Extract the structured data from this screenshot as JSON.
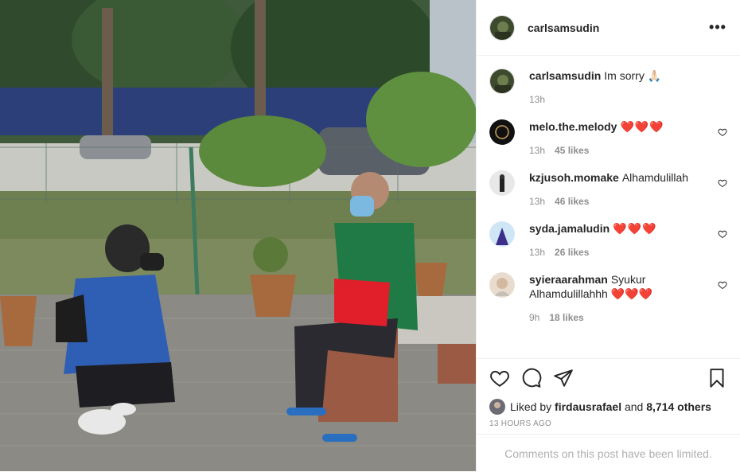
{
  "post": {
    "author": "carlsamsudin",
    "caption": "Im sorry 🙏🏻",
    "caption_time": "13h"
  },
  "comments": [
    {
      "user": "melo.the.melody",
      "text": "❤️❤️❤️",
      "time": "13h",
      "likes": "45 likes"
    },
    {
      "user": "kzjusoh.momake",
      "text": "Alhamdulillah",
      "time": "13h",
      "likes": "46 likes"
    },
    {
      "user": "syda.jamaludin",
      "text": "❤️❤️❤️",
      "time": "13h",
      "likes": "26 likes"
    },
    {
      "user": "syieraarahman",
      "text": "Syukur Alhamdulillahhh ❤️❤️❤️",
      "time": "9h",
      "likes": "18 likes"
    }
  ],
  "likes": {
    "prefix": "Liked by",
    "user": "firdausrafael",
    "and": "and",
    "others": "8,714 others"
  },
  "timestamp": "13 HOURS AGO",
  "comments_limited": "Comments on this post have been limited.",
  "icons": {
    "more": "more-options-icon",
    "like": "heart-icon",
    "comment": "comment-icon",
    "share": "share-icon",
    "save": "bookmark-icon"
  },
  "colors": {
    "heart_red": "#ed4956",
    "meta_gray": "#8e8e8e",
    "border": "#efefef"
  }
}
